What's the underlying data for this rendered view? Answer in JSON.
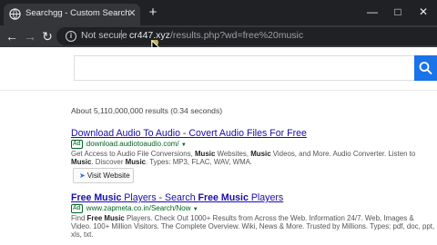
{
  "browser": {
    "tab_title": "Searchgg - Custom Search",
    "tab_close": "✕",
    "new_tab": "+",
    "controls": {
      "minimize": "—",
      "maximize": "□",
      "close": "✕"
    },
    "nav": {
      "back": "←",
      "forward": "→",
      "reload": "↻"
    },
    "address": {
      "security": "Not secure",
      "separator": "|",
      "host": "cr447.xyz",
      "path": "/results.php?wd=free%20music"
    }
  },
  "search": {
    "query": "",
    "accent": "#1a73e8"
  },
  "stats": "About 5,110,000,000 results (0.34 seconds)",
  "results": [
    {
      "title_parts": [
        {
          "text": "Download Audio To Audio - Covert Audio Files For Free",
          "bold": false
        }
      ],
      "ad_badge": "Ad",
      "url": "download.audiotoaudio.com/",
      "desc": [
        {
          "text": "Get Access to Audio File Conversions, ",
          "bold": false
        },
        {
          "text": "Music",
          "bold": true
        },
        {
          "text": " Websites, ",
          "bold": false
        },
        {
          "text": "Music",
          "bold": true
        },
        {
          "text": " Videos, and More. Audio Converter. Listen to ",
          "bold": false
        },
        {
          "text": "Music",
          "bold": true
        },
        {
          "text": ". Discover ",
          "bold": false
        },
        {
          "text": "Music",
          "bold": true
        },
        {
          "text": ". Types: MP3, FLAC, WAV, WMA.",
          "bold": false
        }
      ],
      "button": "Visit Website"
    },
    {
      "title_parts": [
        {
          "text": "Free Music",
          "bold": true
        },
        {
          "text": " Players - Search ",
          "bold": false
        },
        {
          "text": "Free Music",
          "bold": true
        },
        {
          "text": " Players",
          "bold": false
        }
      ],
      "ad_badge": "Ad",
      "url": "www.zapmeta.co.in/Search/Now",
      "desc": [
        {
          "text": "Find ",
          "bold": false
        },
        {
          "text": "Free Music",
          "bold": true
        },
        {
          "text": " Players. Check Out 1000+ Results from Across the Web. Information 24/7. Web, Images & Video. 100+ Million Visitors. The Complete Overview. Wiki, News & More. Trusted by Millions. Types: pdf, doc, ppt, xls, txt.",
          "bold": false
        }
      ]
    }
  ]
}
